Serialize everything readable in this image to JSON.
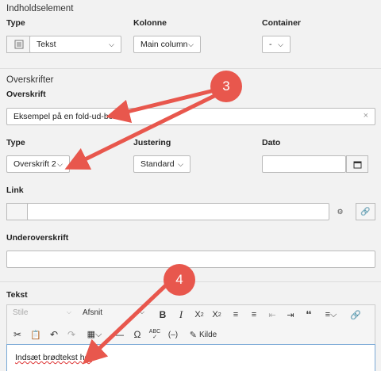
{
  "content_element": {
    "section_title": "Indholdselement",
    "type_label": "Type",
    "type_value": "Tekst",
    "column_label": "Kolonne",
    "column_value": "Main column",
    "container_label": "Container",
    "container_value": "-"
  },
  "headlines": {
    "section_title": "Overskrifter",
    "headline_label": "Overskrift",
    "headline_value": "Eksempel på en fold-ud-boks",
    "type_label": "Type",
    "type_value": "Overskrift 2",
    "alignment_label": "Justering",
    "alignment_value": "Standard",
    "date_label": "Dato",
    "date_value": "",
    "link_label": "Link",
    "link_value": "",
    "subheader_label": "Underoverskrift",
    "subheader_value": ""
  },
  "text": {
    "label": "Tekst",
    "style_label": "Stile",
    "format_label": "Afsnit",
    "source_label": "Kilde",
    "body": "Indsæt brødtekst her"
  },
  "callouts": {
    "badge_3": "3",
    "badge_4": "4",
    "color": "#e8574d"
  },
  "icons": [
    "text-content-icon",
    "clear-icon",
    "calendar-icon",
    "link-browser-icon",
    "link-icon",
    "bold-icon",
    "italic-icon",
    "subscript-icon",
    "superscript-icon",
    "bulleted-list-icon",
    "numbered-list-icon",
    "outdent-icon",
    "indent-icon",
    "blockquote-icon",
    "align-icon",
    "insert-link-icon",
    "cut-icon",
    "paste-icon",
    "undo-icon",
    "redo-icon",
    "table-icon",
    "horizontal-line-icon",
    "special-char-icon",
    "spell-check-icon",
    "soft-hyphen-icon",
    "source-icon"
  ]
}
